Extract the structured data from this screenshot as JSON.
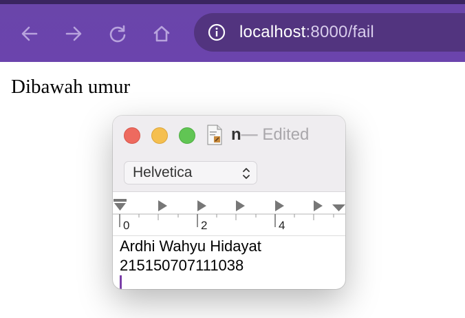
{
  "browser": {
    "url_host": "localhost",
    "url_path": ":8000/fail",
    "icons": [
      "back-arrow-icon",
      "forward-arrow-icon",
      "reload-icon",
      "home-icon",
      "info-icon"
    ],
    "toolbar_color": "#6b44ad",
    "urlbar_color": "#52347f"
  },
  "page": {
    "text": "Dibawah umur"
  },
  "textedit": {
    "doc_name": "n",
    "separator": "—",
    "status": "Edited",
    "font": "Helvetica",
    "ruler_labels": [
      "0",
      "2",
      "4"
    ],
    "lines": [
      "Ardhi Wahyu Hidayat",
      "215150707111038"
    ],
    "traffic_lights": {
      "close": "#ee6a5f",
      "minimize": "#f5bf4f",
      "zoom": "#61c554"
    }
  }
}
